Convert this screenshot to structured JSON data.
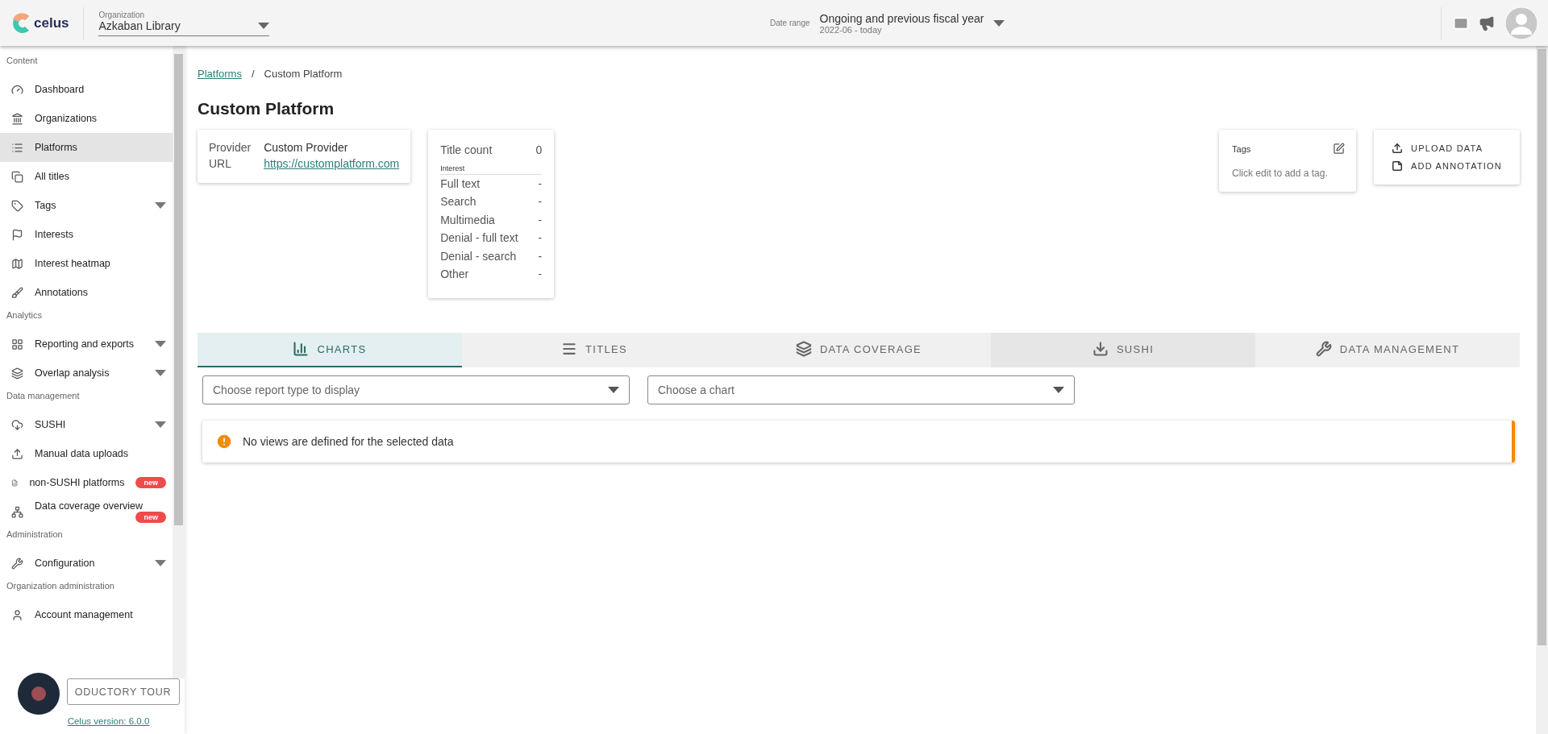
{
  "logo": "celus",
  "header": {
    "org_label": "Organization",
    "org_value": "Azkaban Library",
    "date_label": "Date range",
    "date_value": "Ongoing and previous fiscal year",
    "date_sub": "2022-06 - today"
  },
  "sidebar": {
    "sections": [
      {
        "title": "Content",
        "items": [
          {
            "label": "Dashboard",
            "selected": false,
            "expandable": false
          },
          {
            "label": "Organizations",
            "selected": false,
            "expandable": false
          },
          {
            "label": "Platforms",
            "selected": true,
            "expandable": false
          },
          {
            "label": "All titles",
            "selected": false,
            "expandable": false
          },
          {
            "label": "Tags",
            "selected": false,
            "expandable": true
          },
          {
            "label": "Interests",
            "selected": false,
            "expandable": false
          },
          {
            "label": "Interest heatmap",
            "selected": false,
            "expandable": false
          },
          {
            "label": "Annotations",
            "selected": false,
            "expandable": false
          }
        ]
      },
      {
        "title": "Analytics",
        "items": [
          {
            "label": "Reporting and exports",
            "selected": false,
            "expandable": true
          },
          {
            "label": "Overlap analysis",
            "selected": false,
            "expandable": true
          }
        ]
      },
      {
        "title": "Data management",
        "items": [
          {
            "label": "SUSHI",
            "selected": false,
            "expandable": true
          },
          {
            "label": "Manual data uploads",
            "selected": false,
            "expandable": false
          },
          {
            "label": "non-SUSHI platforms",
            "selected": false,
            "expandable": false,
            "badge": "new"
          },
          {
            "label": "Data coverage overview",
            "selected": false,
            "expandable": false,
            "badge": "new"
          }
        ]
      },
      {
        "title": "Administration",
        "items": [
          {
            "label": "Configuration",
            "selected": false,
            "expandable": true
          }
        ]
      },
      {
        "title": "Organization administration",
        "items": [
          {
            "label": "Account management",
            "selected": false,
            "expandable": false
          }
        ]
      }
    ]
  },
  "tour_button": "ODUCTORY TOUR",
  "version": "Celus version: 6.0.0",
  "breadcrumb": [
    {
      "label": "Platforms",
      "kind": "link"
    },
    {
      "label": "/",
      "kind": "separator"
    },
    {
      "label": "Custom Platform",
      "kind": "current"
    }
  ],
  "title": "Custom Platform",
  "provider_card": [
    {
      "label": "Provider",
      "value": "Custom Provider",
      "kind": "text"
    },
    {
      "label": "URL",
      "value": "https://customplatform.com",
      "kind": "link"
    }
  ],
  "stats_card": {
    "title_count_label": "Title count",
    "title_count_value": "0",
    "interest_heading": "Interest",
    "rows": [
      {
        "label": "Full text",
        "value": "-"
      },
      {
        "label": "Search",
        "value": "-"
      },
      {
        "label": "Multimedia",
        "value": "-"
      },
      {
        "label": "Denial - full text",
        "value": "-"
      },
      {
        "label": "Denial - search",
        "value": "-"
      },
      {
        "label": "Other",
        "value": "-"
      }
    ]
  },
  "tags_card": {
    "heading": "Tags",
    "hint": "Click edit to add a tag."
  },
  "actions": [
    "UPLOAD DATA",
    "ADD ANNOTATION"
  ],
  "tabs": [
    {
      "label": "CHARTS",
      "selected": true
    },
    {
      "label": "TITLES",
      "selected": false
    },
    {
      "label": "DATA COVERAGE",
      "selected": false
    },
    {
      "label": "SUSHI",
      "selected": false
    },
    {
      "label": "DATA MANAGEMENT",
      "selected": false
    }
  ],
  "selects": [
    {
      "placeholder": "Choose report type to display"
    },
    {
      "placeholder": "Choose a chart"
    }
  ],
  "alert": "No views are defined for the selected data"
}
